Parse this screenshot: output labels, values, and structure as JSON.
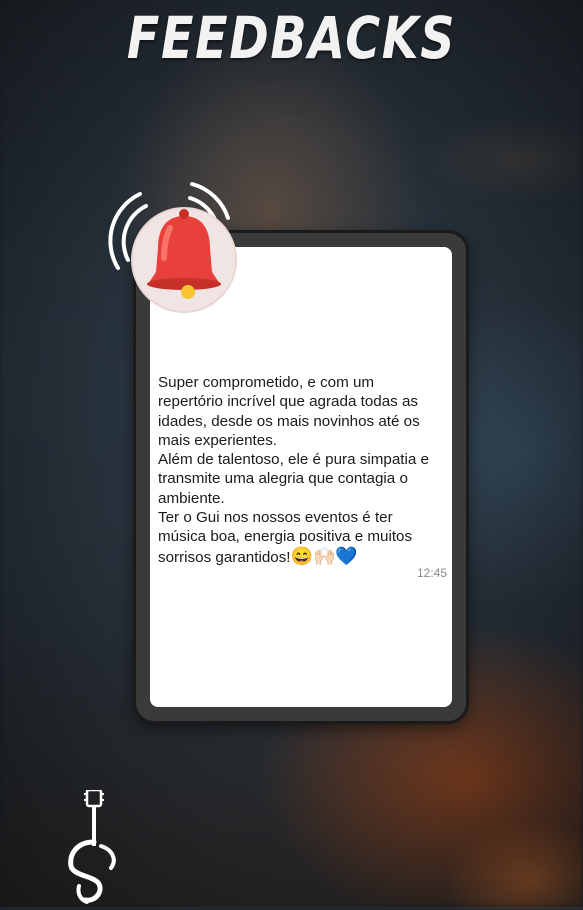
{
  "header": {
    "title": "FEEDBACKS"
  },
  "message": {
    "text": "Super comprometido, e com um repertório incrível que agrada todas as idades, desde os mais novinhos até os mais experientes.\nAlém de talentoso, ele é pura simpatia e transmite uma alegria que contagia o ambiente.\nTer o Gui nos nossos eventos é ter música boa, energia positiva e muitos sorrisos garantidos!",
    "emojis": "😄🙌🏻💙",
    "time": "12:45"
  },
  "icons": {
    "bell": "bell-icon",
    "logo": "guitar-logo-icon"
  },
  "colors": {
    "accent_bell": "#e8403a",
    "background": "#1d2730",
    "screen": "#ffffff"
  }
}
